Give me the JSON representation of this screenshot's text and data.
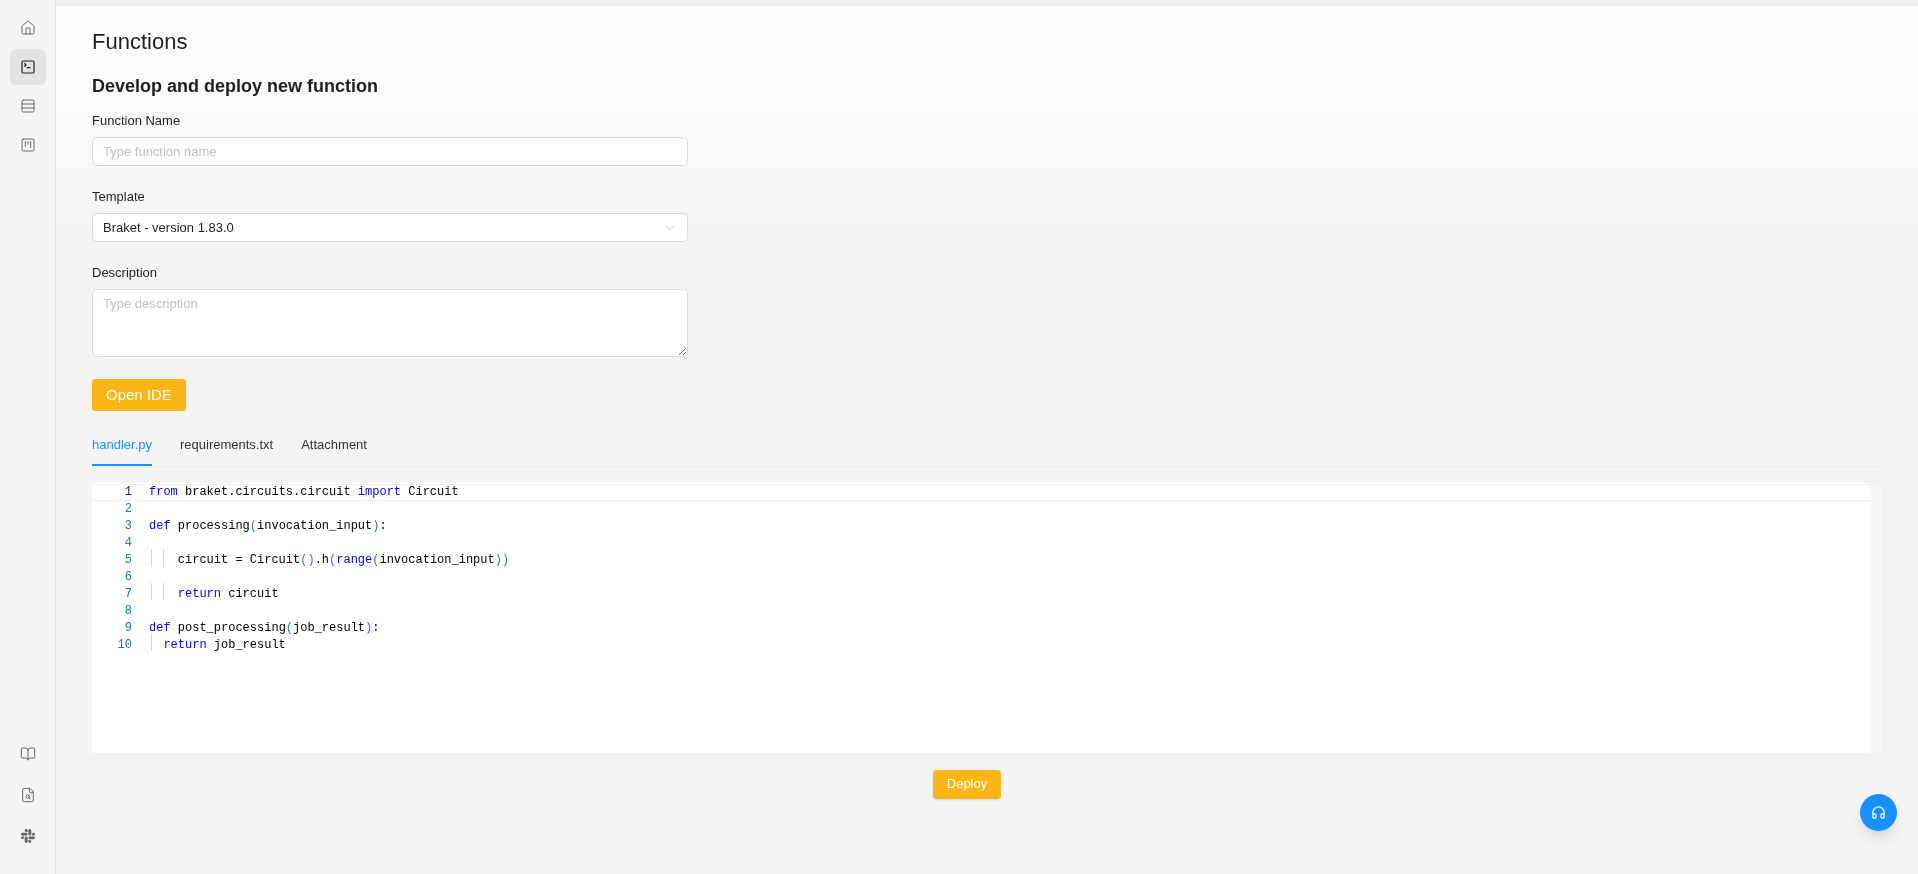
{
  "sidebar": {
    "top_items": [
      {
        "selected": false
      },
      {
        "selected": true
      },
      {
        "selected": false
      },
      {
        "selected": false
      }
    ],
    "bottom_items": [
      {
        "selected": false
      },
      {
        "selected": false
      },
      {
        "selected": false
      }
    ]
  },
  "page_title": "Functions",
  "section_title": "Develop and deploy new function",
  "form": {
    "function_name": {
      "label": "Function Name",
      "placeholder": "Type function name"
    },
    "template": {
      "label": "Template",
      "value": "Braket - version 1.83.0"
    },
    "description": {
      "label": "Description",
      "placeholder": "Type description"
    },
    "open_ide_button": "Open IDE"
  },
  "tabs": [
    {
      "label": "handler.py",
      "selected": true
    },
    {
      "label": "requirements.txt",
      "selected": false
    },
    {
      "label": "Attachment",
      "selected": false
    }
  ],
  "code_lines": [
    {
      "number": "1",
      "current": true,
      "tokens": [
        {
          "kind": "keyword",
          "text": "from"
        },
        {
          "kind": "plain",
          "text": " braket.circuits.circuit "
        },
        {
          "kind": "keyword",
          "text": "import"
        },
        {
          "kind": "plain",
          "text": " Circuit"
        }
      ]
    },
    {
      "number": "2",
      "current": false
    },
    {
      "number": "3",
      "current": false,
      "tokens": [
        {
          "kind": "keyword",
          "text": "def"
        },
        {
          "kind": "plain",
          "text": " processing"
        },
        {
          "kind": "bracket1",
          "text": "("
        },
        {
          "kind": "plain",
          "text": "invocation_input"
        },
        {
          "kind": "bracket1",
          "text": ")"
        },
        {
          "kind": "plain",
          "text": ":"
        }
      ]
    },
    {
      "number": "4",
      "current": false
    },
    {
      "number": "5",
      "current": false,
      "tokens": [
        {
          "kind": "plain",
          "text": "    circuit = Circuit"
        },
        {
          "kind": "bracket1",
          "text": "()"
        },
        {
          "kind": "plain",
          "text": ".h"
        },
        {
          "kind": "bracket1",
          "text": "("
        },
        {
          "kind": "keyword",
          "text": "range"
        },
        {
          "kind": "bracket2",
          "text": "("
        },
        {
          "kind": "plain",
          "text": "invocation_input"
        },
        {
          "kind": "bracket2",
          "text": ")"
        },
        {
          "kind": "bracket1",
          "text": ")"
        }
      ]
    },
    {
      "number": "6",
      "current": false
    },
    {
      "number": "7",
      "current": false,
      "tokens": [
        {
          "kind": "keyword",
          "text": "    return"
        },
        {
          "kind": "plain",
          "text": " circuit"
        }
      ]
    },
    {
      "number": "8",
      "current": false
    },
    {
      "number": "9",
      "current": false,
      "tokens": [
        {
          "kind": "keyword",
          "text": "def"
        },
        {
          "kind": "plain",
          "text": " post_processing"
        },
        {
          "kind": "bracket1",
          "text": "("
        },
        {
          "kind": "plain",
          "text": "job_result"
        },
        {
          "kind": "bracket1",
          "text": ")"
        },
        {
          "kind": "plain",
          "text": ":"
        }
      ]
    },
    {
      "number": "10",
      "current": false,
      "tokens": [
        {
          "kind": "keyword",
          "text": "  return"
        },
        {
          "kind": "plain",
          "text": " job_result"
        }
      ]
    }
  ],
  "deploy_button": "Deploy"
}
